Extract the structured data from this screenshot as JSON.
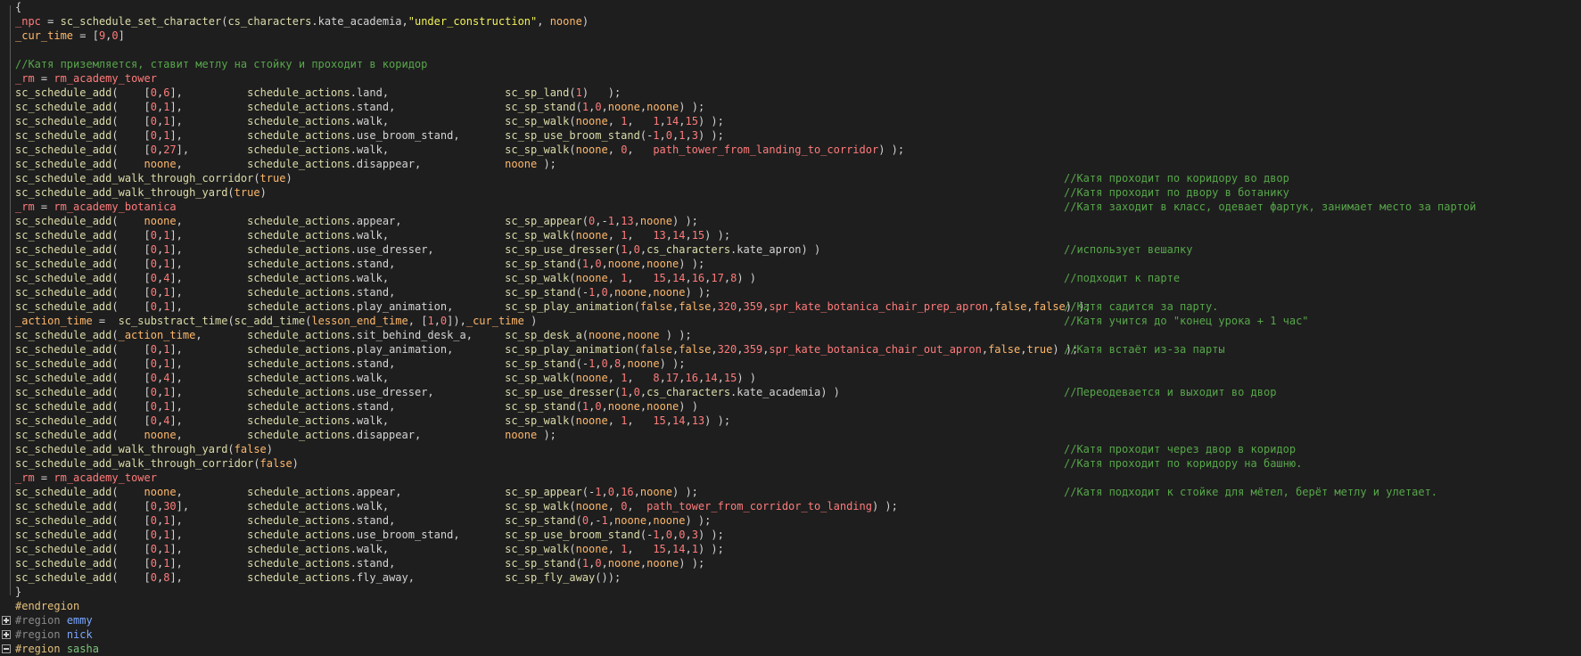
{
  "code": {
    "lines": [
      "{",
      "_npc = sc_schedule_set_character(cs_characters.kate_academia,\"under_construction\", noone)",
      "_cur_time = [9,0]",
      "",
      "//Катя приземляется, ставит метлу на стойку и проходит в коридор",
      "_rm = rm_academy_tower",
      "sc_schedule_add(    [0,6],          schedule_actions.land,                  sc_sp_land(1)   );",
      "sc_schedule_add(    [0,1],          schedule_actions.stand,                 sc_sp_stand(1,0,noone,noone) );",
      "sc_schedule_add(    [0,1],          schedule_actions.walk,                  sc_sp_walk(noone, 1,   1,14,15) );",
      "sc_schedule_add(    [0,1],          schedule_actions.use_broom_stand,       sc_sp_use_broom_stand(-1,0,1,3) );",
      "sc_schedule_add(    [0,27],         schedule_actions.walk,                  sc_sp_walk(noone, 0,   path_tower_from_landing_to_corridor) );",
      "sc_schedule_add(    noone,          schedule_actions.disappear,             noone );",
      "sc_schedule_add_walk_through_corridor(true)",
      "sc_schedule_add_walk_through_yard(true)",
      "_rm = rm_academy_botanica",
      "sc_schedule_add(    noone,          schedule_actions.appear,                sc_sp_appear(0,-1,13,noone) );",
      "sc_schedule_add(    [0,1],          schedule_actions.walk,                  sc_sp_walk(noone, 1,   13,14,15) );",
      "sc_schedule_add(    [0,1],          schedule_actions.use_dresser,           sc_sp_use_dresser(1,0,cs_characters.kate_apron) )",
      "sc_schedule_add(    [0,1],          schedule_actions.stand,                 sc_sp_stand(1,0,noone,noone) );",
      "sc_schedule_add(    [0,4],          schedule_actions.walk,                  sc_sp_walk(noone, 1,   15,14,16,17,8) )",
      "sc_schedule_add(    [0,1],          schedule_actions.stand,                 sc_sp_stand(-1,0,noone,noone) );",
      "sc_schedule_add(    [0,1],          schedule_actions.play_animation,        sc_sp_play_animation(false,false,320,359,spr_kate_botanica_chair_prep_apron,false,false) );",
      "_action_time =  sc_substract_time(sc_add_time(lesson_end_time, [1,0]),_cur_time )",
      "sc_schedule_add(_action_time,       schedule_actions.sit_behind_desk_a,     sc_sp_desk_a(noone,noone ) );",
      "sc_schedule_add(    [0,1],          schedule_actions.play_animation,        sc_sp_play_animation(false,false,320,359,spr_kate_botanica_chair_out_apron,false,true) );",
      "sc_schedule_add(    [0,1],          schedule_actions.stand,                 sc_sp_stand(-1,0,8,noone) );",
      "sc_schedule_add(    [0,4],          schedule_actions.walk,                  sc_sp_walk(noone, 1,   8,17,16,14,15) )",
      "sc_schedule_add(    [0,1],          schedule_actions.use_dresser,           sc_sp_use_dresser(1,0,cs_characters.kate_academia) )",
      "sc_schedule_add(    [0,1],          schedule_actions.stand,                 sc_sp_stand(1,0,noone,noone) )",
      "sc_schedule_add(    [0,4],          schedule_actions.walk,                  sc_sp_walk(noone, 1,   15,14,13) );",
      "sc_schedule_add(    noone,          schedule_actions.disappear,             noone );",
      "sc_schedule_add_walk_through_yard(false)",
      "sc_schedule_add_walk_through_corridor(false)",
      "_rm = rm_academy_tower",
      "sc_schedule_add(    noone,          schedule_actions.appear,                sc_sp_appear(-1,0,16,noone) );",
      "sc_schedule_add(    [0,30],         schedule_actions.walk,                  sc_sp_walk(noone, 0,  path_tower_from_corridor_to_landing) );",
      "sc_schedule_add(    [0,1],          schedule_actions.stand,                 sc_sp_stand(0,-1,noone,noone) );",
      "sc_schedule_add(    [0,1],          schedule_actions.use_broom_stand,       sc_sp_use_broom_stand(-1,0,0,3) );",
      "sc_schedule_add(    [0,1],          schedule_actions.walk,                  sc_sp_walk(noone, 1,   15,14,1) );",
      "sc_schedule_add(    [0,1],          schedule_actions.stand,                 sc_sp_stand(1,0,noone,noone) );",
      "sc_schedule_add(    [0,8],          schedule_actions.fly_away,              sc_sp_fly_away());",
      "}",
      "#endregion"
    ],
    "comments": {
      "12": "//Катя проходит по коридору во двор",
      "13": "//Катя проходит по двору в ботанику",
      "14": "//Катя заходит в класс, одевает фартук, занимает место за партой",
      "17": "//использует вешалку",
      "19": "//подходит к парте",
      "21": "//Катя садится за парту.",
      "22": "//Катя учится до \"конец урока + 1 час\"",
      "24": "//Катя встаёт из-за парты",
      "27": "//Переодевается и выходит во двор",
      "31": "//Катя проходит через двор в коридор",
      "32": "//Катя проходит по коридору на башню.",
      "34": "//Катя подходит к стойке для мётел, берёт метлу и улетает."
    },
    "regions": [
      {
        "keyword": "#region",
        "name": "emmy",
        "collapsed": true
      },
      {
        "keyword": "#region",
        "name": "nick",
        "collapsed": true
      },
      {
        "keyword": "#region",
        "name": "sasha",
        "collapsed": false
      }
    ]
  },
  "colors": {
    "background": "#1e1e1e",
    "comment": "#57a64a",
    "keyword": "#d7ba7d",
    "identifier": "#ff7b7b",
    "string": "#f2f25a",
    "function": "#dcdcaa"
  }
}
